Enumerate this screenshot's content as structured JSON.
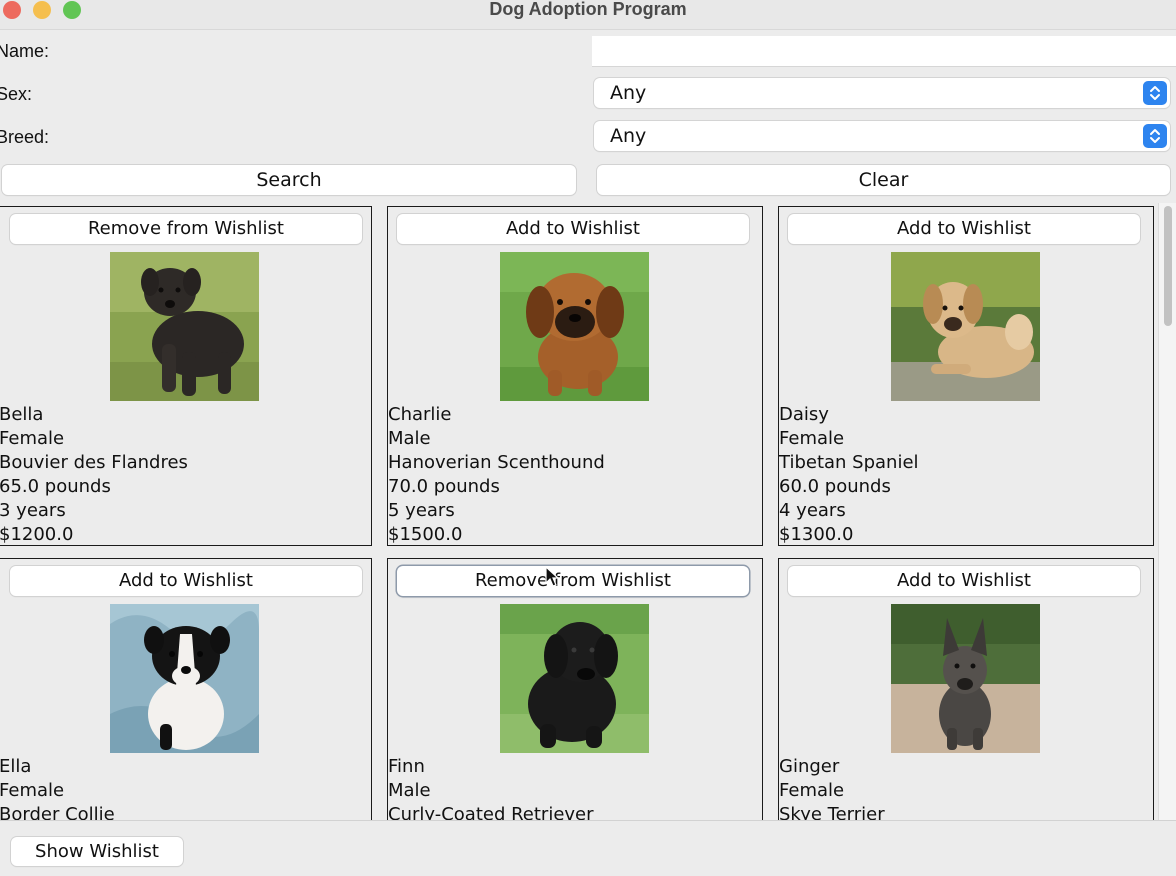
{
  "window": {
    "title": "Dog Adoption Program"
  },
  "form": {
    "name_label": "Name:",
    "name_value": "",
    "sex_label": "Sex:",
    "sex_selected": "Any",
    "breed_label": "Breed:",
    "breed_selected": "Any",
    "search_label": "Search",
    "clear_label": "Clear"
  },
  "dogs": [
    {
      "button": "Remove from Wishlist",
      "name": "Bella",
      "sex": "Female",
      "breed": "Bouvier des Flandres",
      "weight": "65.0 pounds",
      "age": "3 years",
      "price": "$1200.0"
    },
    {
      "button": "Add to Wishlist",
      "name": "Charlie",
      "sex": "Male",
      "breed": "Hanoverian Scenthound",
      "weight": "70.0 pounds",
      "age": "5 years",
      "price": "$1500.0"
    },
    {
      "button": "Add to Wishlist",
      "name": "Daisy",
      "sex": "Female",
      "breed": "Tibetan Spaniel",
      "weight": "60.0 pounds",
      "age": "4 years",
      "price": "$1300.0"
    },
    {
      "button": "Add to Wishlist",
      "name": "Ella",
      "sex": "Female",
      "breed": "Border Collie"
    },
    {
      "button": "Remove from Wishlist",
      "name": "Finn",
      "sex": "Male",
      "breed": "Curly-Coated Retriever"
    },
    {
      "button": "Add to Wishlist",
      "name": "Ginger",
      "sex": "Female",
      "breed": "Skye Terrier"
    }
  ],
  "footer": {
    "show_wishlist_label": "Show Wishlist"
  },
  "colors": {
    "close": "#ed6a5e",
    "minimize": "#f5bf4f",
    "zoom": "#61c554",
    "select_accent": "#2d84ef"
  }
}
